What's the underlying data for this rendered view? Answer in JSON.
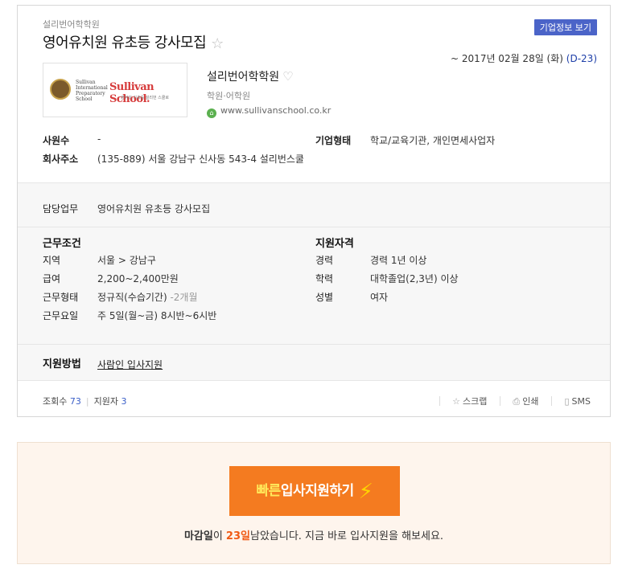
{
  "job": {
    "company_small": "설리번어학학원",
    "title": "영어유치원 유초등 강사모집",
    "info_button": "기업정보 보기",
    "deadline_prefix": "~ 2017년 02월 28일 (화)",
    "dday": "(D-23)"
  },
  "company": {
    "logo_text": "Sullivan School.",
    "logo_crest_text": "Sullivan International Preparatory School",
    "logo_sub": "영어의 기초를 설리번 스쿨로",
    "name": "설리번어학학원",
    "category": "학원·어학원",
    "url": "www.sullivanschool.co.kr"
  },
  "profile": {
    "employees_label": "사원수",
    "employees_value": "-",
    "type_label": "기업형태",
    "type_value": "학교/교육기관, 개인면세사업자",
    "address_label": "회사주소",
    "address_value": "(135-889) 서울 강남구 신사동 543-4 설리번스쿨"
  },
  "duty": {
    "label": "담당업무",
    "value": "영어유치원 유초등 강사모집"
  },
  "conditions": {
    "title": "근무조건",
    "rows": [
      {
        "label": "지역",
        "value": "서울 > 강남구",
        "note": ""
      },
      {
        "label": "급여",
        "value": "2,200~2,400만원",
        "note": ""
      },
      {
        "label": "근무형태",
        "value": "정규직(수습기간)",
        "note": " -2개월"
      },
      {
        "label": "근무요일",
        "value": "주 5일(월~금) 8시반~6시반",
        "note": ""
      }
    ]
  },
  "qualifications": {
    "title": "지원자격",
    "rows": [
      {
        "label": "경력",
        "value": "경력 1년 이상"
      },
      {
        "label": "학력",
        "value": "대학졸업(2,3년) 이상"
      },
      {
        "label": "성별",
        "value": "여자"
      }
    ]
  },
  "apply": {
    "label": "지원방법",
    "link": "사람인 입사지원"
  },
  "stats": {
    "views_label": "조회수",
    "views": "73",
    "applicants_label": "지원자",
    "applicants": "3"
  },
  "tools": {
    "scrap": "스크랩",
    "print": "인쇄",
    "sms": "SMS"
  },
  "cta": {
    "button_highlight": "빠른",
    "button_rest": "입사지원하기",
    "msg_strong": "마감일",
    "msg_mid": "이 ",
    "msg_days": "23일",
    "msg_rest": "남았습니다. 지금 바로 입사지원을 해보세요."
  },
  "colors": {
    "accent": "#4b64c8",
    "cta": "#f47b20",
    "dday": "#1d3ea8"
  }
}
